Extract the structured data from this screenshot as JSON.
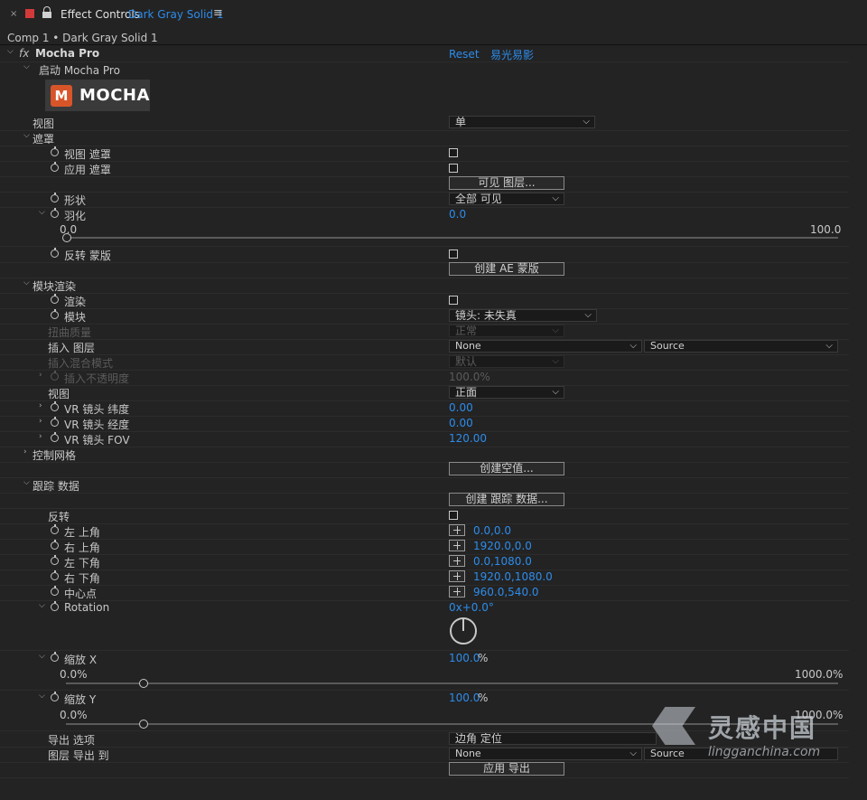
{
  "tab": {
    "close": "×",
    "title": "Effect Controls",
    "layer": "Dark Gray Solid 1",
    "menu": "≡"
  },
  "breadcrumb": "Comp 1 • Dark Gray Solid 1",
  "effect": {
    "fx": "fx",
    "name": "Mocha Pro",
    "reset": "Reset",
    "about": "易光易影",
    "launch": "启动 Mocha Pro",
    "logo_mark": "M",
    "logo_word": "MOCHA"
  },
  "view": {
    "label": "视图",
    "value": "单"
  },
  "matte": {
    "section": "遮罩",
    "view_matte": "视图 遮罩",
    "apply_matte": "应用 遮罩",
    "visible_layers_btn": "可见 图层...",
    "shape": "形状",
    "shape_value": "全部 可见",
    "feather": "羽化",
    "feather_value": "0.0",
    "feather_min": "0.0",
    "feather_max": "100.0",
    "invert": "反转 蒙版",
    "create_ae_masks_btn": "创建 AE 蒙版"
  },
  "module": {
    "section": "模块渲染",
    "render": "渲染",
    "module": "模块",
    "module_value": "镜头: 未失真",
    "warp_quality": "扭曲质量",
    "warp_quality_value": "正常",
    "insert_layer": "插入 图层",
    "insert_layer_value": "None",
    "insert_source_value": "Source",
    "insert_blend": "插入混合模式",
    "insert_blend_value": "默认",
    "insert_opacity": "插入不透明度",
    "insert_opacity_value": "100.0%",
    "view": "视图",
    "view_value": "正面",
    "vr_lat": "VR 镜头 纬度",
    "vr_lat_value": "0.00",
    "vr_long": "VR 镜头 经度",
    "vr_long_value": "0.00",
    "vr_fov": "VR 镜头 FOV",
    "vr_fov_value": "120.00"
  },
  "mesh": {
    "section": "控制网格",
    "create_null_btn": "创建空值..."
  },
  "tracking": {
    "section": "跟踪 数据",
    "create_tracking_btn": "创建 跟踪 数据...",
    "invert": "反转",
    "top_left": "左 上角",
    "top_left_value": "0.0,0.0",
    "top_right": "右 上角",
    "top_right_value": "1920.0,0.0",
    "bottom_left": "左 下角",
    "bottom_left_value": "0.0,1080.0",
    "bottom_right": "右 下角",
    "bottom_right_value": "1920.0,1080.0",
    "center": "中心点",
    "center_value": "960.0,540.0",
    "rotation": "Rotation",
    "rotation_value": "0x+0.0°",
    "scale_x": "缩放 X",
    "scale_x_value": "100.0",
    "scale_x_unit": "%",
    "scale_x_min": "0.0%",
    "scale_x_max": "1000.0%",
    "scale_y": "缩放 Y",
    "scale_y_value": "100.0",
    "scale_y_unit": "%",
    "scale_y_min": "0.0%",
    "scale_y_max": "1000.0%",
    "export_option": "导出 选项",
    "export_option_value": "边角 定位",
    "layer_export_to": "图层 导出 到",
    "layer_export_value": "None",
    "layer_export_source": "Source",
    "apply_export_btn": "应用 导出"
  },
  "watermark": {
    "cn": "灵感中国",
    "en": "lingganchina.com"
  },
  "colors": {
    "accent": "#2d8ceb",
    "bg": "#232323",
    "tab_red": "#d23a3a",
    "logo_orange": "#d8552a"
  }
}
